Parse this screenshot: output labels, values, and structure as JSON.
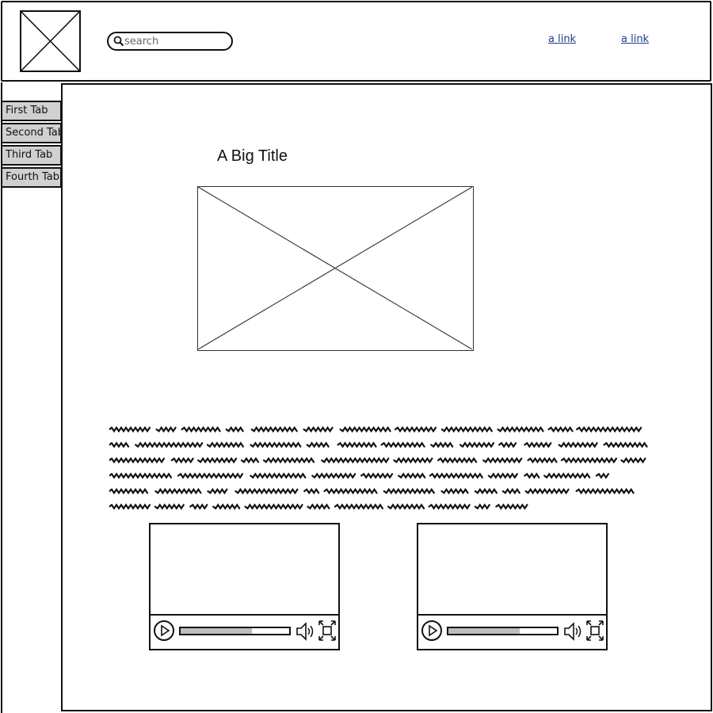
{
  "header": {
    "search": {
      "placeholder": "search",
      "value": ""
    },
    "links": [
      "a link",
      "a link"
    ]
  },
  "sidebar": {
    "tabs": [
      {
        "label": "First Tab"
      },
      {
        "label": "Second Tab"
      },
      {
        "label": "Third Tab"
      },
      {
        "label": "Fourth Tab"
      }
    ]
  },
  "main": {
    "title": "A Big Title",
    "videos": [
      {
        "progress": 0.66
      },
      {
        "progress": 0.66
      }
    ]
  },
  "icons": {
    "logo": "image-placeholder-icon",
    "search": "search-icon",
    "hero": "image-placeholder-icon",
    "play": "play-icon",
    "volume": "volume-icon",
    "fullscreen": "fullscreen-icon"
  },
  "colors": {
    "link": "#1b3c8a",
    "tab_bg": "#d0d0d0",
    "progress_fill": "#bdbdbd",
    "scribble": "#111111"
  }
}
